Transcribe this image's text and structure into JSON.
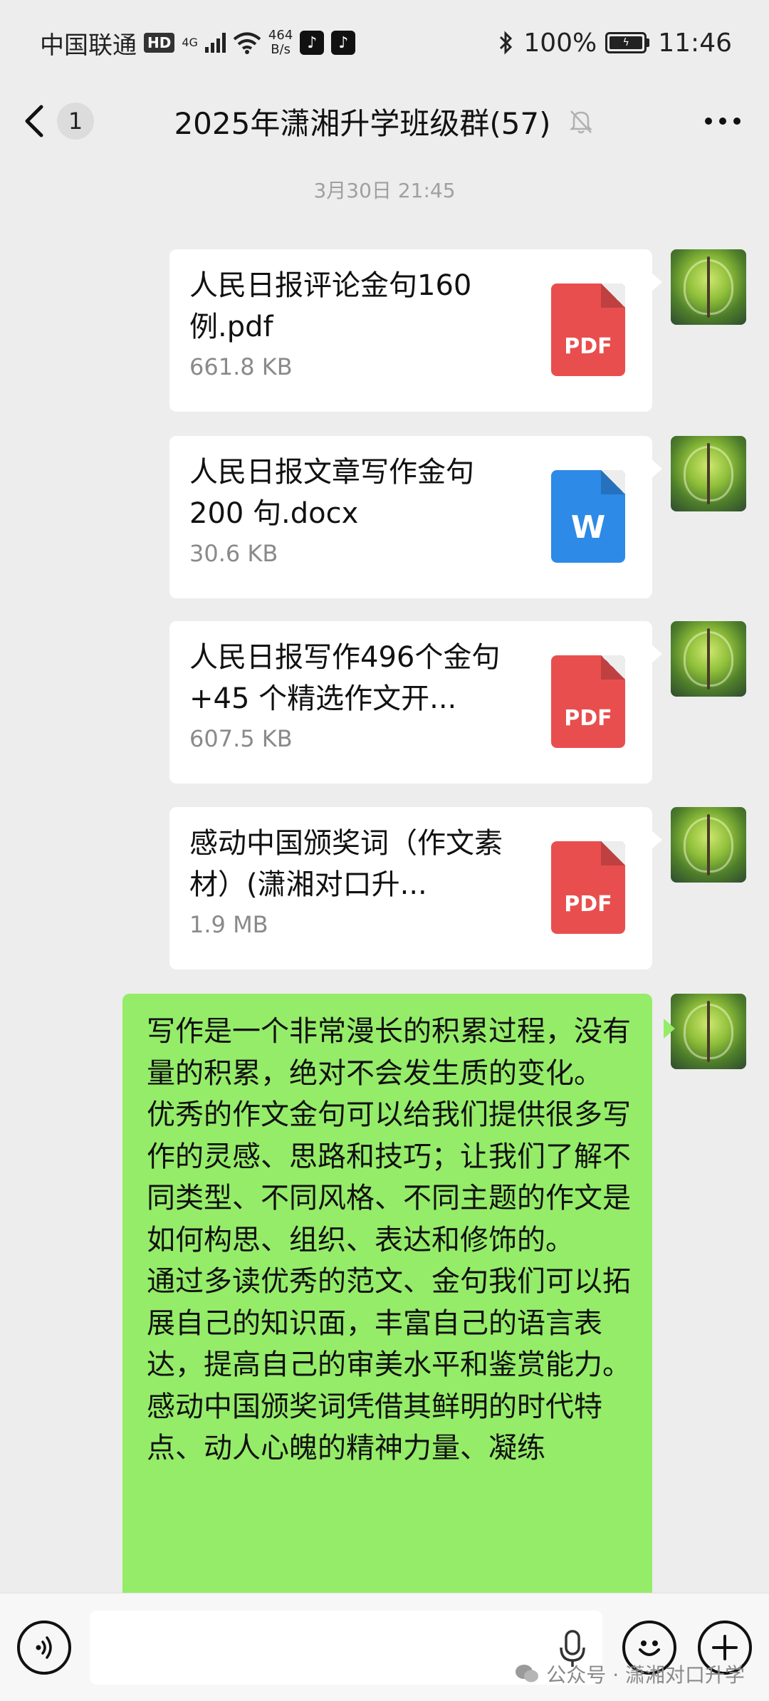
{
  "status_bar": {
    "carrier": "中国联通",
    "hd": "HD",
    "network": "4G",
    "net_speed_value": "464",
    "net_speed_unit": "B/s",
    "app_icons": [
      "tiktok-icon",
      "tiktok-icon"
    ],
    "battery": "100%",
    "battery_level": 1.0,
    "time": "11:46"
  },
  "nav": {
    "back_badge": "1",
    "title": "2025年潇湘升学班级群(57)",
    "muted": true
  },
  "chat": {
    "timestamp": "3月30日 21:45",
    "files": [
      {
        "name": "人民日报评论金句160例.pdf",
        "size": "661.8 KB",
        "icon_label": "PDF",
        "type": "pdf"
      },
      {
        "name": "人民日报文章写作金句200 句.docx",
        "size": "30.6 KB",
        "icon_label": "W",
        "type": "doc"
      },
      {
        "name": "人民日报写作496个金句+45 个精选作文开...",
        "size": "607.5 KB",
        "icon_label": "PDF",
        "type": "pdf"
      },
      {
        "name": "感动中国颁奖词（作文素材）(潇湘对口升...",
        "size": "1.9 MB",
        "icon_label": "PDF",
        "type": "pdf"
      }
    ],
    "text_message": {
      "paragraphs": [
        "写作是一个非常漫长的积累过程，没有量的积累，绝对不会发生质的变化。",
        "优秀的作文金句可以给我们提供很多写作的灵感、思路和技巧；让我们了解不同类型、不同风格、不同主题的作文是如何构思、组织、表达和修饰的。",
        "通过多读优秀的范文、金句我们可以拓展自己的知识面，丰富自己的语言表达，提高自己的审美水平和鉴赏能力。",
        "感动中国颁奖词凭借其鲜明的时代特点、动人心魄的精神力量、凝练"
      ]
    }
  },
  "input_bar": {
    "voice_icon": "voice-icon",
    "mic_icon": "mic-icon",
    "emoji_icon": "emoji-icon",
    "plus_icon": "plus-icon"
  },
  "watermark": {
    "text": "公众号 · 潇湘对口升学"
  },
  "colors": {
    "background": "#ededed",
    "sent_bubble": "#95ec69",
    "pdf": "#e94e4e",
    "word": "#2d8ae6"
  }
}
